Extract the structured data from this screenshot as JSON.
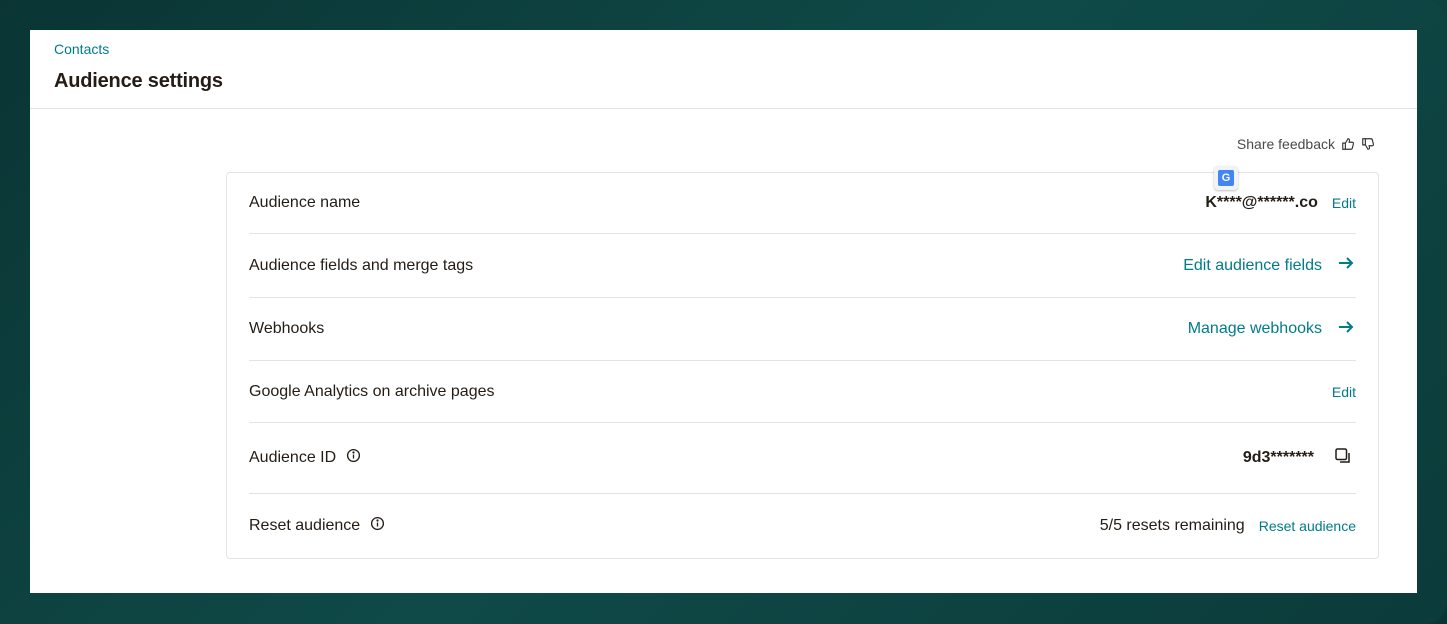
{
  "header": {
    "breadcrumb": "Contacts",
    "title": "Audience settings"
  },
  "feedback": {
    "label": "Share feedback",
    "thumbs_up_icon": "thumbs-up-icon",
    "thumbs_down_icon": "thumbs-down-icon"
  },
  "translate_badge": {
    "icon": "google-translate-icon",
    "glyph": "G"
  },
  "rows": [
    {
      "label": "Audience name",
      "value": "K****@******.co",
      "action": "Edit"
    },
    {
      "label": "Audience fields and merge tags",
      "action": "Edit audience fields",
      "icon": "arrow-right-icon"
    },
    {
      "label": "Webhooks",
      "action": "Manage webhooks",
      "icon": "arrow-right-icon"
    },
    {
      "label": "Google Analytics on archive pages",
      "action": "Edit"
    },
    {
      "label": "Audience ID",
      "value": "9d3*******",
      "icon": "copy-icon",
      "label_icon": "info-icon"
    },
    {
      "label": "Reset audience",
      "value": "5/5 resets remaining",
      "action": "Reset audience",
      "label_icon": "info-icon"
    }
  ],
  "colors": {
    "accent": "#007c89",
    "text": "#241c15",
    "background": "#0b3b3a"
  }
}
